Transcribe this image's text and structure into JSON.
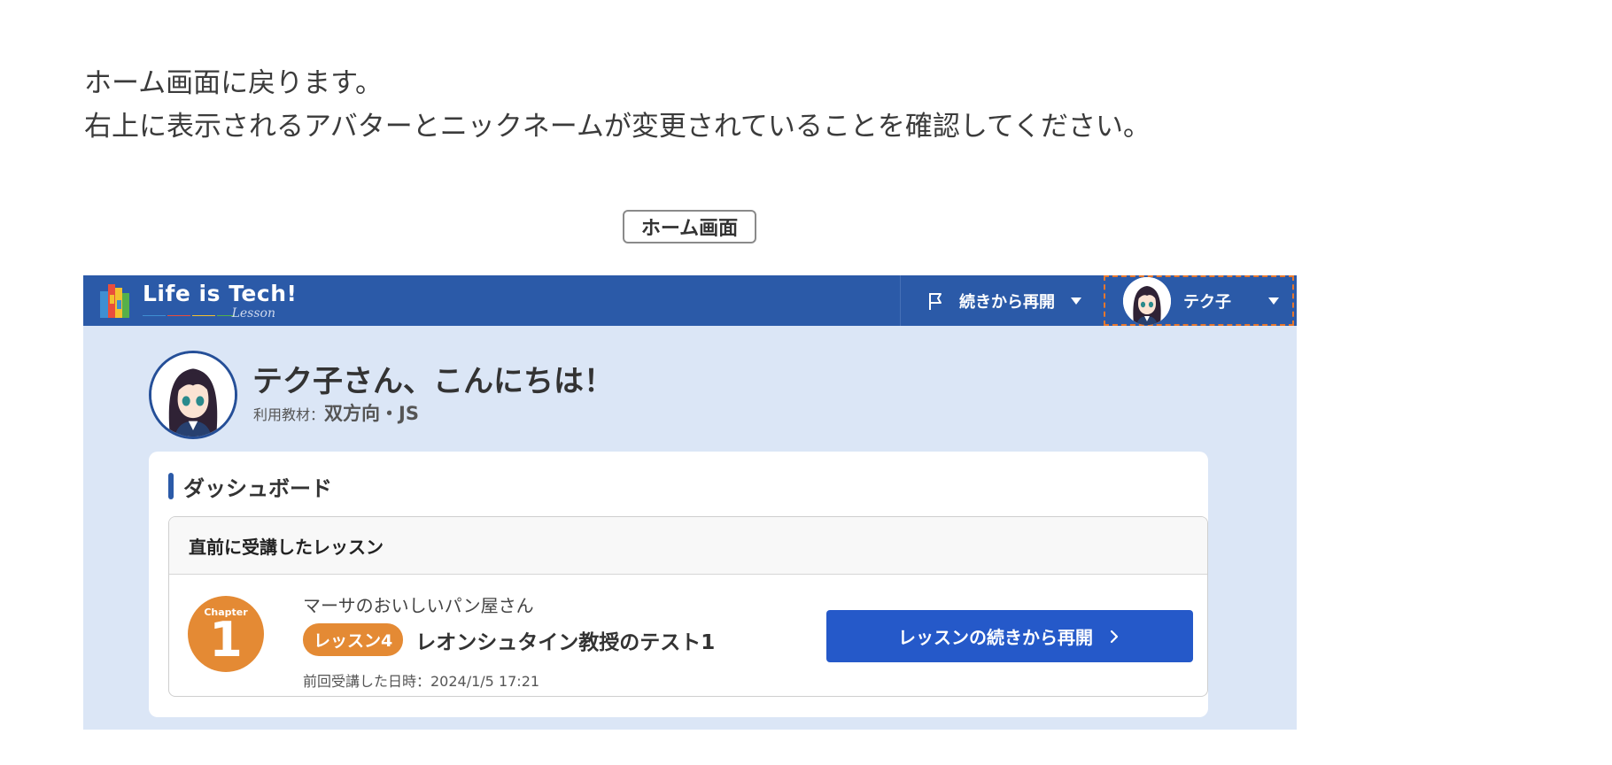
{
  "intro": {
    "line1": "ホーム画面に戻ります。",
    "line2": "右上に表示されるアバターとニックネームが変更されていることを確認してください。"
  },
  "caption": "ホーム画面",
  "app": {
    "logo_text": "Life is Tech!",
    "logo_sub": "Lesson",
    "header": {
      "resume_label": "続きから再開",
      "user_name": "テク子"
    },
    "greeting": {
      "title": "テク子さん、こんにちは！",
      "material_label": "利用教材：",
      "material_value": "双方向・JS"
    },
    "dashboard": {
      "title": "ダッシュボード",
      "recent_header": "直前に受講したレッスン",
      "chapter_label": "Chapter",
      "chapter_number": "1",
      "course_name": "マーサのおいしいパン屋さん",
      "lesson_badge": "レッスン4",
      "lesson_title": "レオンシュタイン教授のテスト1",
      "last_attended": "前回受講した日時：2024/1/5 17:21",
      "resume_button": "レッスンの続きから再開"
    }
  },
  "colors": {
    "header_blue": "#2b5aa8",
    "button_blue": "#2559c9",
    "accent_orange": "#e48a34",
    "page_bg": "#dbe6f6"
  },
  "icons": {
    "flag": "flag-icon",
    "caret": "caret-down-icon",
    "chevron": "chevron-right-icon"
  }
}
